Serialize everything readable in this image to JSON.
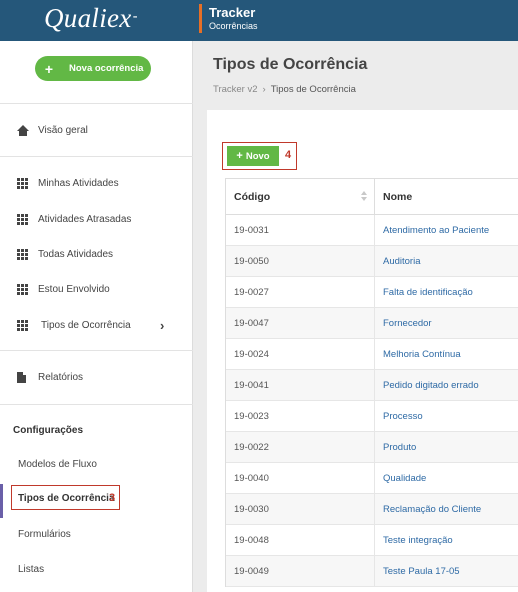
{
  "brand": {
    "logo_text": "Qualiex",
    "logo_caret": "-"
  },
  "header": {
    "title": "Tracker",
    "subtitle": "Ocorrências"
  },
  "sidebar": {
    "new_button_label": "Nova ocorrência",
    "items": [
      {
        "label": "Visão geral",
        "icon": "home-icon"
      },
      {
        "label": "Minhas Atividades",
        "icon": "grid-icon"
      },
      {
        "label": "Atividades Atrasadas",
        "icon": "grid-icon"
      },
      {
        "label": "Todas Atividades",
        "icon": "grid-icon"
      },
      {
        "label": "Estou Envolvido",
        "icon": "grid-icon"
      },
      {
        "label": "Tipos de Ocorrência",
        "icon": "grid-icon",
        "chevron": "›"
      },
      {
        "label": "Relatórios",
        "icon": "document-icon"
      }
    ],
    "config_heading": "Configurações",
    "config_items": [
      {
        "label": "Modelos de Fluxo"
      },
      {
        "label": "Tipos de Ocorrência",
        "active": true,
        "annotation": "3"
      },
      {
        "label": "Formulários"
      },
      {
        "label": "Listas"
      }
    ]
  },
  "main": {
    "page_title": "Tipos de Ocorrência",
    "breadcrumb": [
      "Tracker v2",
      "›",
      "Tipos de Ocorrência"
    ],
    "novo_button": {
      "label": "Novo",
      "annotation": "4"
    },
    "table": {
      "columns": [
        "Código",
        "Nome"
      ],
      "rows": [
        [
          "19-0031",
          "Atendimento ao Paciente"
        ],
        [
          "19-0050",
          "Auditoria"
        ],
        [
          "19-0027",
          "Falta de identificação"
        ],
        [
          "19-0047",
          "Fornecedor"
        ],
        [
          "19-0024",
          "Melhoria Contínua"
        ],
        [
          "19-0041",
          "Pedido digitado errado"
        ],
        [
          "19-0023",
          "Processo"
        ],
        [
          "19-0022",
          "Produto"
        ],
        [
          "19-0040",
          "Qualidade"
        ],
        [
          "19-0030",
          "Reclamação do Cliente"
        ],
        [
          "19-0048",
          "Teste integração"
        ],
        [
          "19-0049",
          "Teste Paula 17-05"
        ]
      ]
    }
  },
  "colors": {
    "topbar": "#25577a",
    "accent": "#e76f26",
    "green": "#62b845",
    "annotation_red": "#c0392b",
    "link_blue": "#2e6aa5",
    "active_marker": "#6a5fa8"
  }
}
